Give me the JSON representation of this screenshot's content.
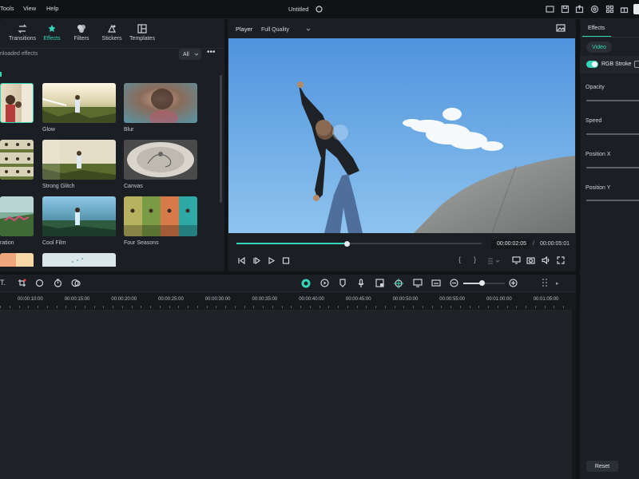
{
  "menubar": {
    "items": [
      "Tools",
      "View",
      "Help"
    ],
    "title": "Untitled"
  },
  "library": {
    "tabs": [
      {
        "label": "Transitions",
        "icon": "transitions-icon"
      },
      {
        "label": "Effects",
        "icon": "effects-icon"
      },
      {
        "label": "Filters",
        "icon": "filters-icon"
      },
      {
        "label": "Stickers",
        "icon": "stickers-icon"
      },
      {
        "label": "Templates",
        "icon": "templates-icon"
      }
    ],
    "active_tab": "Effects",
    "filter_label": "nloaded effects",
    "filter_select": "All",
    "effects": [
      {
        "label": ""
      },
      {
        "label": "Glow"
      },
      {
        "label": "Blur"
      },
      {
        "label": ""
      },
      {
        "label": "Strong Glitch"
      },
      {
        "label": "Canvas"
      },
      {
        "label": "ration"
      },
      {
        "label": "Cool Film"
      },
      {
        "label": "Four Seasons"
      }
    ]
  },
  "player": {
    "label": "Player",
    "quality": "Full Quality",
    "current_time": "00:00:02:05",
    "total_time": "00:00:05:01",
    "progress": 0.45,
    "separator": "/"
  },
  "properties": {
    "tab": "Effects",
    "subtab": "Video",
    "toggle_label": "RGB Stroke",
    "toggle_on": true,
    "sliders": [
      "Opacity",
      "Speed",
      "Position X",
      "Position Y"
    ],
    "reset_label": "Reset"
  },
  "timeline": {
    "ruler": [
      "00:00:10:00",
      "00:00:15:00",
      "00:00:20:00",
      "00:00:25:00",
      "00:00:30:00",
      "00:00:35:00",
      "00:00:40:00",
      "00:00:45:00",
      "00:00:50:00",
      "00:00:55:00",
      "00:01:00:00",
      "00:01:05:00"
    ]
  },
  "colors": {
    "accent": "#36d6b8",
    "panel": "#1b1e23",
    "background": "#111316"
  }
}
